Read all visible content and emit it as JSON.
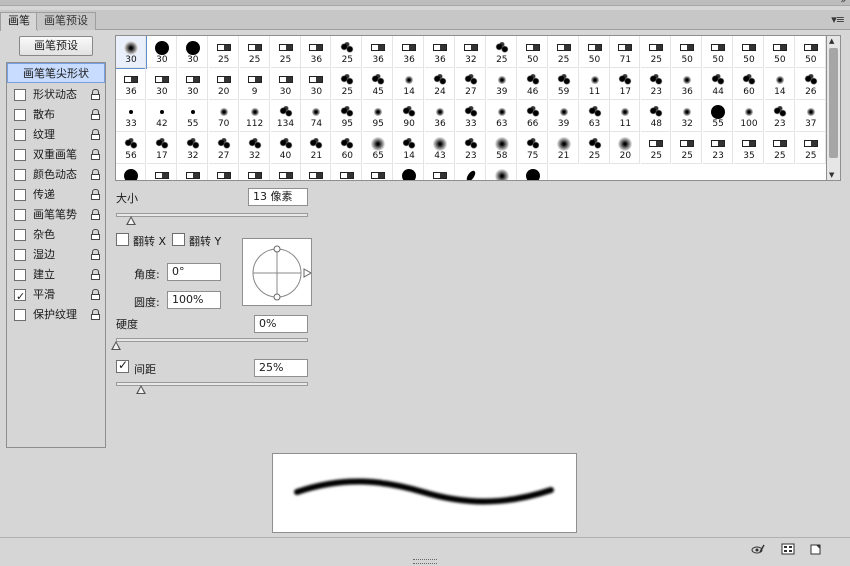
{
  "panel": {
    "tabs": [
      {
        "label": "画笔"
      },
      {
        "label": "画笔预设"
      }
    ],
    "collapse_icon": "double-chevron-right-icon",
    "menu_icon": "panel-menu-icon"
  },
  "sidebar": {
    "preset_button": "画笔预设",
    "items": [
      {
        "label": "画笔笔尖形状",
        "checked": null,
        "locked": false,
        "selected": true
      },
      {
        "label": "形状动态",
        "checked": false,
        "locked": true
      },
      {
        "label": "散布",
        "checked": false,
        "locked": true
      },
      {
        "label": "纹理",
        "checked": false,
        "locked": true
      },
      {
        "label": "双重画笔",
        "checked": false,
        "locked": true
      },
      {
        "label": "颜色动态",
        "checked": false,
        "locked": true
      },
      {
        "label": "传递",
        "checked": false,
        "locked": true
      },
      {
        "label": "画笔笔势",
        "checked": false,
        "locked": true
      },
      {
        "label": "杂色",
        "checked": false,
        "locked": true
      },
      {
        "label": "湿边",
        "checked": false,
        "locked": true
      },
      {
        "label": "建立",
        "checked": false,
        "locked": true
      },
      {
        "label": "平滑",
        "checked": true,
        "locked": true
      },
      {
        "label": "保护纹理",
        "checked": false,
        "locked": true
      }
    ]
  },
  "brushes": {
    "rows": [
      [
        "30",
        "30",
        "30",
        "25",
        "25",
        "25",
        "36",
        "25",
        "36",
        "36",
        "36",
        "32",
        "25",
        "50",
        "25",
        "50",
        "71",
        "25",
        "50",
        "50",
        "50",
        "50",
        "50"
      ],
      [
        "36",
        "30",
        "30",
        "20",
        "9",
        "30",
        "30",
        "25",
        "45",
        "14",
        "24",
        "27",
        "39",
        "46",
        "59",
        "11",
        "17",
        "23",
        "36",
        "44",
        "60",
        "14",
        "26"
      ],
      [
        "33",
        "42",
        "55",
        "70",
        "112",
        "134",
        "74",
        "95",
        "95",
        "90",
        "36",
        "33",
        "63",
        "66",
        "39",
        "63",
        "11",
        "48",
        "32",
        "55",
        "100",
        "23",
        "37"
      ],
      [
        "56",
        "17",
        "32",
        "27",
        "32",
        "40",
        "21",
        "60",
        "65",
        "14",
        "43",
        "23",
        "58",
        "75",
        "21",
        "25",
        "20",
        "25",
        "25",
        "23",
        "35",
        "25",
        "25"
      ],
      [
        "",
        "",
        "",
        "",
        "",
        "",
        "",
        "",
        "",
        "",
        "",
        "",
        "",
        ""
      ]
    ],
    "selected_index": 0,
    "scroll_up_icon": "triangle-up-icon",
    "scroll_down_icon": "triangle-down-icon"
  },
  "tip": {
    "size_label": "大小",
    "size_value": "13 像素",
    "size_level": 0.08,
    "flip_x_label": "翻转 X",
    "flip_y_label": "翻转 Y",
    "flip_x": false,
    "flip_y": false,
    "angle_label": "角度:",
    "angle_value": "0°",
    "roundness_label": "圆度:",
    "roundness_value": "100%",
    "hardness_label": "硬度",
    "hardness_value": "0%",
    "hardness_level": 0.0,
    "spacing_label": "间距",
    "spacing_value": "25%",
    "spacing_checked": true,
    "spacing_level": 0.13
  },
  "footer": {
    "icons": [
      "eye-brush-toggle-icon",
      "brush-grid-icon",
      "new-brush-icon"
    ]
  }
}
